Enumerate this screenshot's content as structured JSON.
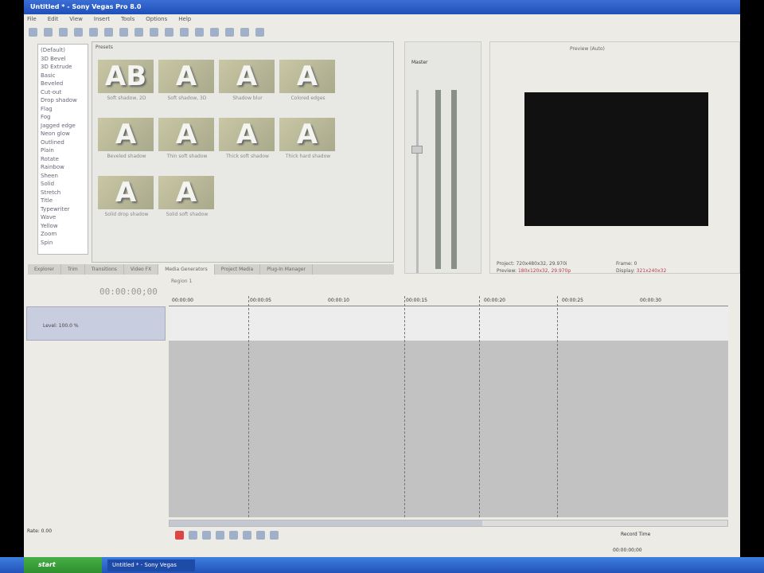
{
  "window": {
    "title": "Untitled * - Sony Vegas Pro 8.0"
  },
  "menu": [
    "File",
    "Edit",
    "View",
    "Insert",
    "Tools",
    "Options",
    "Help"
  ],
  "generators": [
    "(Default)",
    "3D Bevel",
    "3D Extrude",
    "Basic",
    "Beveled",
    "Cut-out",
    "Drop shadow",
    "Flag",
    "Fog",
    "Jagged edge",
    "Neon glow",
    "Outlined",
    "Plain",
    "Rotate",
    "Rainbow",
    "Sheen",
    "Solid",
    "Stretch",
    "Title",
    "Typewriter",
    "Wave",
    "Yellow",
    "Zoom",
    "Spin"
  ],
  "presets_label": "Presets",
  "thumbnails": [
    {
      "glyph": "AB",
      "caption": "Soft shadow, 2D"
    },
    {
      "glyph": "A",
      "caption": "Soft shadow, 3D"
    },
    {
      "glyph": "A",
      "caption": "Shadow blur"
    },
    {
      "glyph": "A",
      "caption": "Colored edges"
    },
    {
      "glyph": "A",
      "caption": "Beveled shadow"
    },
    {
      "glyph": "A",
      "caption": "Thin soft shadow"
    },
    {
      "glyph": "A",
      "caption": "Thick soft shadow"
    },
    {
      "glyph": "A",
      "caption": "Thick hard shadow"
    },
    {
      "glyph": "A",
      "caption": "Solid drop shadow"
    },
    {
      "glyph": "A",
      "caption": "Solid soft shadow"
    }
  ],
  "tabs": [
    "Explorer",
    "Trim",
    "Transitions",
    "Video FX",
    "Media Generators",
    "Project Media",
    "Plug-In Manager"
  ],
  "mixer": {
    "label": "Master"
  },
  "preview": {
    "mode": "Preview (Auto)",
    "project_label": "Project:",
    "project_value": "720x480x32, 29.970i",
    "preview_label": "Preview:",
    "preview_value": "180x120x32, 29.970p",
    "frame_label": "Frame:",
    "frame_value": "0",
    "display_label": "Display:",
    "display_value": "321x240x32"
  },
  "timeline": {
    "timecode": "00:00:00;00",
    "region": "Region 1",
    "ruler": [
      "00:00:00",
      "00:00:05",
      "00:00:10",
      "00:00:15",
      "00:00:20",
      "00:00:25",
      "00:00:30"
    ],
    "track_label": "Level: 100.0 %"
  },
  "transport": {
    "rate_label": "Rate: 0.00",
    "record_time": "Record Time",
    "status": "00:00:00;00"
  },
  "taskbar": {
    "start": "start",
    "task": "Untitled * - Sony Vegas"
  }
}
